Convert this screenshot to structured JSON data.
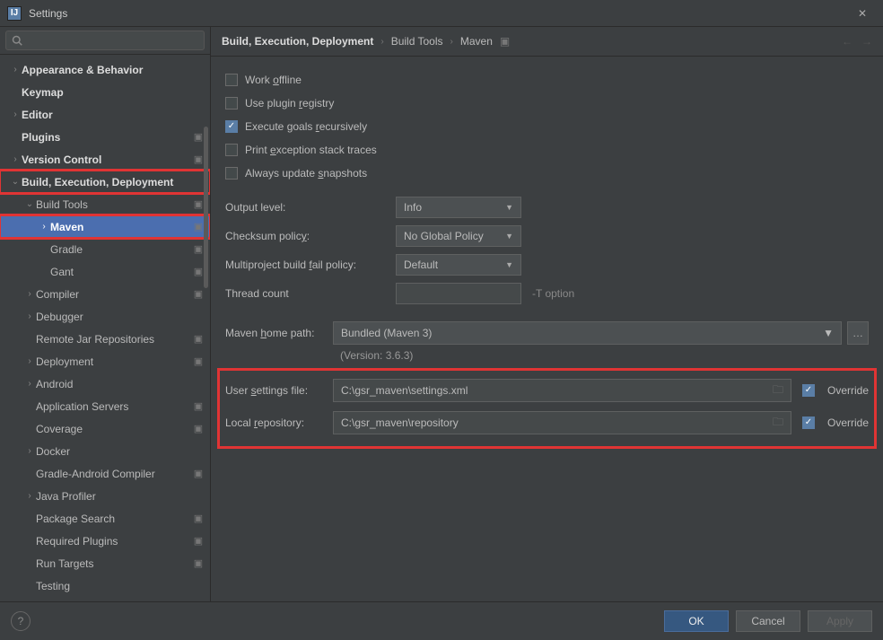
{
  "window": {
    "title": "Settings"
  },
  "search": {
    "placeholder": ""
  },
  "tree": [
    {
      "label": "Appearance & Behavior",
      "indent": 0,
      "arrow": "right",
      "bold": true,
      "marker": false,
      "red": false
    },
    {
      "label": "Keymap",
      "indent": 0,
      "arrow": "",
      "bold": true,
      "marker": false,
      "red": false
    },
    {
      "label": "Editor",
      "indent": 0,
      "arrow": "right",
      "bold": true,
      "marker": false,
      "red": false
    },
    {
      "label": "Plugins",
      "indent": 0,
      "arrow": "",
      "bold": true,
      "marker": true,
      "red": false
    },
    {
      "label": "Version Control",
      "indent": 0,
      "arrow": "right",
      "bold": true,
      "marker": true,
      "red": false
    },
    {
      "label": "Build, Execution, Deployment",
      "indent": 0,
      "arrow": "down",
      "bold": true,
      "marker": false,
      "red": true
    },
    {
      "label": "Build Tools",
      "indent": 1,
      "arrow": "down",
      "bold": false,
      "marker": true,
      "red": false
    },
    {
      "label": "Maven",
      "indent": 2,
      "arrow": "right",
      "bold": false,
      "marker": true,
      "red": true,
      "selected": true
    },
    {
      "label": "Gradle",
      "indent": 2,
      "arrow": "",
      "bold": false,
      "marker": true,
      "red": false
    },
    {
      "label": "Gant",
      "indent": 2,
      "arrow": "",
      "bold": false,
      "marker": true,
      "red": false
    },
    {
      "label": "Compiler",
      "indent": 1,
      "arrow": "right",
      "bold": false,
      "marker": true,
      "red": false
    },
    {
      "label": "Debugger",
      "indent": 1,
      "arrow": "right",
      "bold": false,
      "marker": false,
      "red": false
    },
    {
      "label": "Remote Jar Repositories",
      "indent": 1,
      "arrow": "",
      "bold": false,
      "marker": true,
      "red": false
    },
    {
      "label": "Deployment",
      "indent": 1,
      "arrow": "right",
      "bold": false,
      "marker": true,
      "red": false
    },
    {
      "label": "Android",
      "indent": 1,
      "arrow": "right",
      "bold": false,
      "marker": false,
      "red": false
    },
    {
      "label": "Application Servers",
      "indent": 1,
      "arrow": "",
      "bold": false,
      "marker": true,
      "red": false
    },
    {
      "label": "Coverage",
      "indent": 1,
      "arrow": "",
      "bold": false,
      "marker": true,
      "red": false
    },
    {
      "label": "Docker",
      "indent": 1,
      "arrow": "right",
      "bold": false,
      "marker": false,
      "red": false
    },
    {
      "label": "Gradle-Android Compiler",
      "indent": 1,
      "arrow": "",
      "bold": false,
      "marker": true,
      "red": false
    },
    {
      "label": "Java Profiler",
      "indent": 1,
      "arrow": "right",
      "bold": false,
      "marker": false,
      "red": false
    },
    {
      "label": "Package Search",
      "indent": 1,
      "arrow": "",
      "bold": false,
      "marker": true,
      "red": false
    },
    {
      "label": "Required Plugins",
      "indent": 1,
      "arrow": "",
      "bold": false,
      "marker": true,
      "red": false
    },
    {
      "label": "Run Targets",
      "indent": 1,
      "arrow": "",
      "bold": false,
      "marker": true,
      "red": false
    },
    {
      "label": "Testing",
      "indent": 1,
      "arrow": "",
      "bold": false,
      "marker": false,
      "red": false
    }
  ],
  "breadcrumb": {
    "items": [
      "Build, Execution, Deployment",
      "Build Tools",
      "Maven"
    ]
  },
  "checks": {
    "work_offline": {
      "label_pre": "Work ",
      "ul": "o",
      "label_post": "ffline",
      "checked": false
    },
    "use_plugin_registry": {
      "label_pre": "Use plugin ",
      "ul": "r",
      "label_post": "egistry",
      "checked": false
    },
    "execute_goals": {
      "label_pre": "Execute goals ",
      "ul": "r",
      "label_post": "ecursively",
      "checked": true
    },
    "print_exception": {
      "label_pre": "Print ",
      "ul": "e",
      "label_post": "xception stack traces",
      "checked": false
    },
    "always_update": {
      "label_pre": "Always update ",
      "ul": "s",
      "label_post": "napshots",
      "checked": false
    }
  },
  "controls": {
    "output_level": {
      "label": "Output level:",
      "value": "Info"
    },
    "checksum_policy": {
      "label_pre": "Checksum polic",
      "ul": "y",
      "label_post": ":",
      "value": "No Global Policy"
    },
    "multi_build_fail": {
      "label_pre": "Multiproject build ",
      "ul": "f",
      "label_post": "ail policy:",
      "value": "Default"
    },
    "thread_count": {
      "label": "Thread count",
      "value": "",
      "hint": "-T option"
    },
    "maven_home": {
      "label_pre": "Maven ",
      "ul": "h",
      "label_post": "ome path:",
      "value": "Bundled (Maven 3)"
    },
    "version": "(Version: 3.6.3)",
    "user_settings": {
      "label_pre": "User ",
      "ul": "s",
      "label_post": "ettings file:",
      "value": "C:\\gsr_maven\\settings.xml",
      "override_checked": true,
      "override_label": "Override"
    },
    "local_repo": {
      "label_pre": "Local ",
      "ul": "r",
      "label_post": "epository:",
      "value": "C:\\gsr_maven\\repository",
      "override_checked": true,
      "override_label": "Override"
    }
  },
  "buttons": {
    "ok": "OK",
    "cancel": "Cancel",
    "apply": "Apply"
  }
}
